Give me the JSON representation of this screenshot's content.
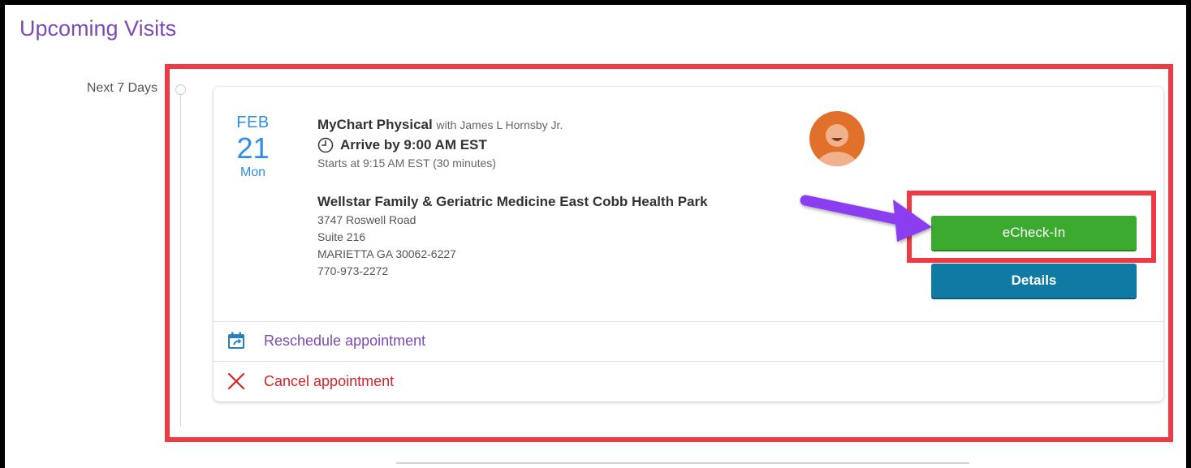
{
  "page": {
    "title": "Upcoming Visits"
  },
  "section": {
    "label": "Next 7 Days"
  },
  "appointment": {
    "month": "FEB",
    "day": "21",
    "weekday": "Mon",
    "visit_type": "MyChart Physical",
    "provider_text": "with James L Hornsby Jr.",
    "arrive_text": "Arrive by 9:00 AM EST",
    "starts_text": "Starts at 9:15 AM EST (30 minutes)",
    "location": {
      "name": "Wellstar Family & Geriatric Medicine East Cobb Health Park",
      "address_line1": "3747 Roswell Road",
      "address_line2": "Suite 216",
      "city_state_zip": "MARIETTA GA 30062-6227",
      "phone": "770-973-2272"
    },
    "buttons": {
      "echeck_label": "eCheck-In",
      "details_label": "Details"
    },
    "actions": {
      "reschedule_label": "Reschedule appointment",
      "cancel_label": "Cancel appointment"
    }
  },
  "icons": {
    "clock": "clock-icon",
    "avatar": "provider-avatar-icon",
    "reschedule": "calendar-reschedule-icon",
    "cancel": "close-x-icon",
    "annotation_arrow": "purple-arrow-icon"
  },
  "colors": {
    "title_purple": "#7c4ab3",
    "date_blue": "#2f8fe6",
    "echeck_green": "#3caa2f",
    "details_blue": "#0f7aa3",
    "cancel_red": "#d6242b",
    "highlight_red": "#ee3a43",
    "arrow_purple": "#8b3cf0",
    "avatar_orange": "#e0702a"
  }
}
